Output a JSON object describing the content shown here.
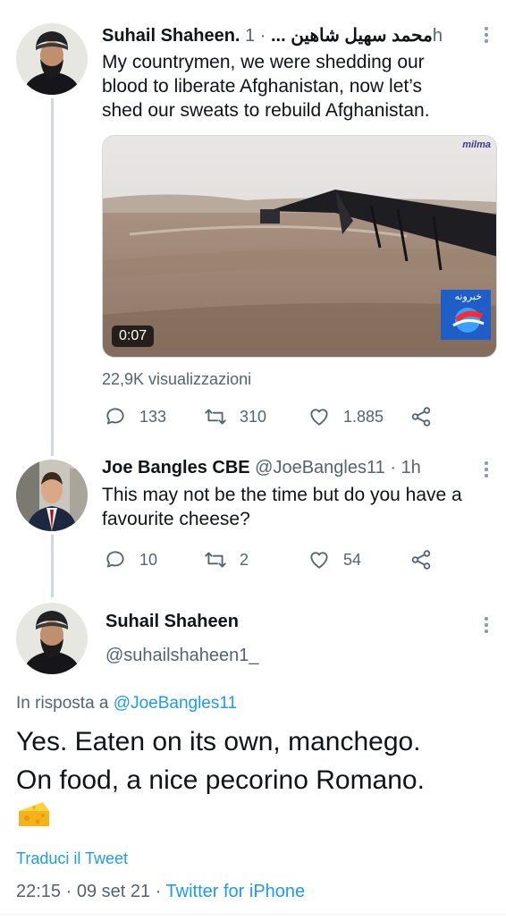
{
  "tweet1": {
    "name": "Suhail Shaheen. محمد سهيل شاهين ...",
    "dot": "·",
    "time": "1h",
    "text_lines": [
      "My countrymen, we were shedding our",
      "blood to liberate Afghanistan, now let’s",
      "shed  our sweats to rebuild Afghanistan."
    ],
    "video": {
      "duration": "0:07",
      "watermark": "milma",
      "channel_logo_text": "خبرونه"
    },
    "views": "22,9K visualizzazioni",
    "counts": {
      "reply": "133",
      "retweet": "310",
      "like": "1.885"
    }
  },
  "tweet2": {
    "name": "Joe Bangles CBE",
    "handle": "@JoeBangles11",
    "dot": "·",
    "time": "1h",
    "text_lines": [
      "This may not be the time but do you have a",
      "favourite cheese?"
    ],
    "counts": {
      "reply": "10",
      "retweet": "2",
      "like": "54"
    }
  },
  "tweet3": {
    "name": "Suhail Shaheen",
    "handle": "@suhailshaheen1_",
    "reply_prefix": "In risposta a",
    "reply_to": "@JoeBangles11",
    "text_lines": [
      "Yes.  Eaten on its own, manchego.",
      "On food, a nice pecorino Romano."
    ],
    "emoji": "cheese-wedge",
    "translate": "Traduci il Tweet",
    "timestamp": "22:15 · 09 set 21 ·",
    "source": "Twitter for iPhone"
  },
  "colors": {
    "text": "#0f1419",
    "secondary": "#536471",
    "accent": "#1d9bf0",
    "thread_line": "#cfd9de"
  }
}
